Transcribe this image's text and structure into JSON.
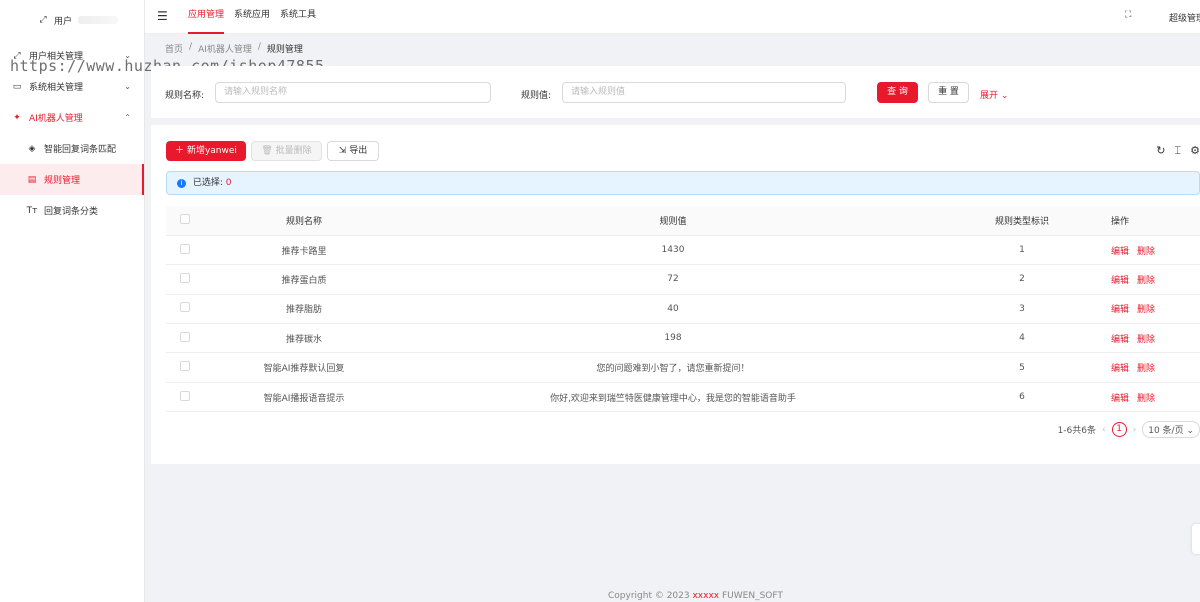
{
  "sidebar": {
    "user_label": "用户",
    "items": [
      {
        "label": "用户相关管理",
        "caret": "⌄"
      },
      {
        "label": "系统相关管理",
        "caret": "⌄"
      },
      {
        "label": "AI机器人管理",
        "caret": "⌃"
      },
      {
        "label": "智能回复词条匹配"
      },
      {
        "label": "规则管理"
      },
      {
        "label": "回复词条分类"
      }
    ]
  },
  "topbar": {
    "tabs": [
      "应用管理",
      "系统应用",
      "系统工具"
    ],
    "user": "超级管理员"
  },
  "breadcrumb": [
    "首页",
    "AI机器人管理",
    "规则管理"
  ],
  "watermark": "https://www.huzhan.com/ishop47855",
  "search": {
    "name_label": "规则名称:",
    "name_placeholder": "请输入规则名称",
    "value_label": "规则值:",
    "value_placeholder": "请输入规则值",
    "query": "查 询",
    "reset": "重 置",
    "expand": "展开"
  },
  "toolbar": {
    "add": "新增yanwei",
    "batch_delete": "批量删除",
    "export": "导出"
  },
  "alert": {
    "label": "已选择:",
    "count": "0"
  },
  "table": {
    "headers": [
      "规则名称",
      "规则值",
      "规则类型标识",
      "操作"
    ],
    "rows": [
      {
        "name": "推荐卡路里",
        "value": "1430",
        "type": "1"
      },
      {
        "name": "推荐蛋白质",
        "value": "72",
        "type": "2"
      },
      {
        "name": "推荐脂肪",
        "value": "40",
        "type": "3"
      },
      {
        "name": "推荐碳水",
        "value": "198",
        "type": "4"
      },
      {
        "name": "智能AI推荐默认回复",
        "value": "您的问题难到小智了，请您重新提问！",
        "type": "5"
      },
      {
        "name": "智能AI播报语音提示",
        "value": "你好,欢迎来到瑞竺特医健康管理中心，我是您的智能语音助手",
        "type": "6"
      }
    ],
    "edit": "编辑",
    "delete": "删除"
  },
  "pagination": {
    "total": "1-6共6条",
    "page": "1",
    "size": "10 条/页"
  },
  "footer": {
    "prefix": "Copyright © 2023",
    "brand": "xxxxx",
    "suffix": "FUWEN_SOFT"
  },
  "colors": {
    "accent": "#e8192c",
    "info": "#1677ff"
  }
}
